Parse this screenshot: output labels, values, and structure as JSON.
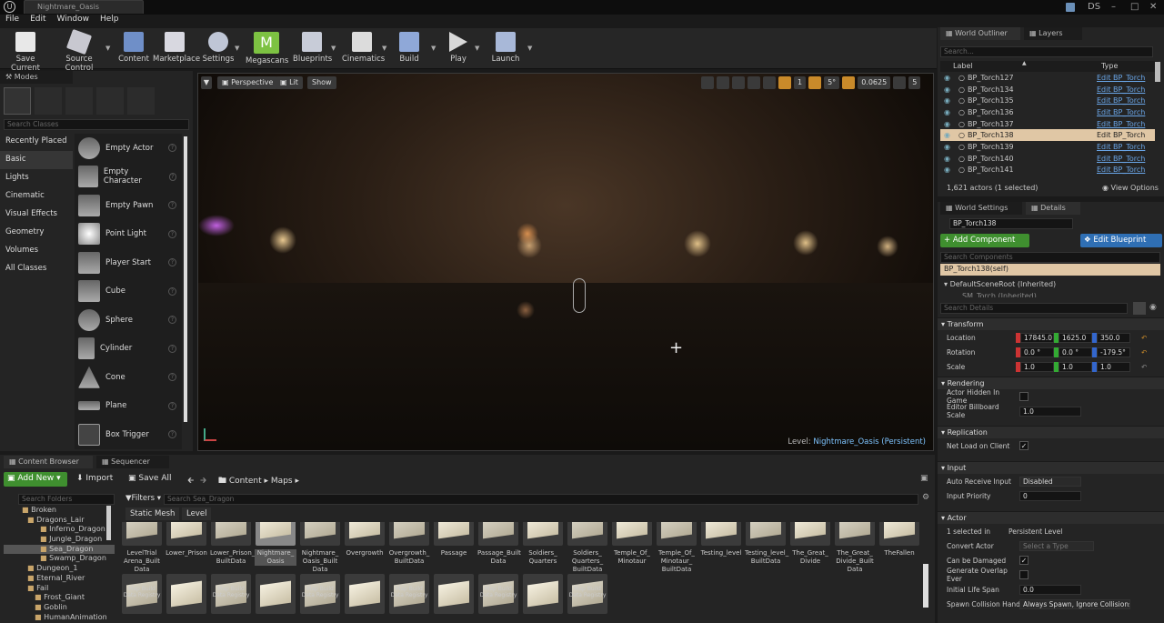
{
  "window": {
    "tab": "Nightmare_Oasis",
    "user": "DS"
  },
  "menu": [
    "File",
    "Edit",
    "Window",
    "Help"
  ],
  "toolbar": [
    "Save Current",
    "Source Control",
    "Content",
    "Marketplace",
    "Settings",
    "Megascans",
    "Blueprints",
    "Cinematics",
    "Build",
    "Play",
    "Launch"
  ],
  "modes": {
    "title": "Modes",
    "search_placeholder": "Search Classes",
    "categories": [
      "Recently Placed",
      "Basic",
      "Lights",
      "Cinematic",
      "Visual Effects",
      "Geometry",
      "Volumes",
      "All Classes"
    ],
    "items": [
      "Empty Actor",
      "Empty Character",
      "Empty Pawn",
      "Point Light",
      "Player Start",
      "Cube",
      "Sphere",
      "Cylinder",
      "Cone",
      "Plane",
      "Box Trigger"
    ]
  },
  "viewport": {
    "perspective": "Perspective",
    "lit": "Lit",
    "show": "Show",
    "grid": "1",
    "angle": "5°",
    "scale": "0.0625",
    "speed": "5",
    "level_label": "Level:",
    "level_name": "Nightmare_Oasis (Persistent)"
  },
  "outliner": {
    "tabs": [
      "World Outliner",
      "Layers"
    ],
    "search_placeholder": "Search...",
    "col_label": "Label",
    "col_type": "Type",
    "rows": [
      {
        "name": "BP_Torch127",
        "type": "Edit BP_Torch"
      },
      {
        "name": "BP_Torch134",
        "type": "Edit BP_Torch"
      },
      {
        "name": "BP_Torch135",
        "type": "Edit BP_Torch"
      },
      {
        "name": "BP_Torch136",
        "type": "Edit BP_Torch"
      },
      {
        "name": "BP_Torch137",
        "type": "Edit BP_Torch"
      },
      {
        "name": "BP_Torch138",
        "type": "Edit BP_Torch"
      },
      {
        "name": "BP_Torch139",
        "type": "Edit BP_Torch"
      },
      {
        "name": "BP_Torch140",
        "type": "Edit BP_Torch"
      },
      {
        "name": "BP_Torch141",
        "type": "Edit BP_Torch"
      }
    ],
    "selected_index": 5,
    "status": "1,621 actors (1 selected)",
    "view_options": "View Options"
  },
  "details": {
    "tabs": [
      "World Settings",
      "Details"
    ],
    "actor_name": "BP_Torch138",
    "add_component": "+ Add Component",
    "edit_blueprint": "Edit Blueprint",
    "search_components": "Search Components",
    "comp_self": "BP_Torch138(self)",
    "comp_root": "DefaultSceneRoot (Inherited)",
    "comp_child": "SM_Torch (Inherited)",
    "search_details": "Search Details",
    "transform": {
      "title": "Transform",
      "location_label": "Location",
      "rotation_label": "Rotation",
      "scale_label": "Scale",
      "location": [
        "17845.0",
        "1625.0",
        "350.0"
      ],
      "rotation": [
        "0.0 °",
        "0.0 °",
        "-179.5°"
      ],
      "scale": [
        "1.0",
        "1.0",
        "1.0"
      ]
    },
    "rendering": {
      "title": "Rendering",
      "hidden_label": "Actor Hidden In Game",
      "billboard_label": "Editor Billboard Scale",
      "billboard": "1.0"
    },
    "replication": {
      "title": "Replication",
      "net_label": "Net Load on Client"
    },
    "input": {
      "title": "Input",
      "auto_label": "Auto Receive Input",
      "auto": "Disabled",
      "priority_label": "Input Priority",
      "priority": "0"
    },
    "actor": {
      "title": "Actor",
      "selected": "1 selected in",
      "persistent": "Persistent Level",
      "convert_label": "Convert Actor",
      "convert": "Select a Type",
      "damaged_label": "Can be Damaged",
      "overlap_label": "Generate Overlap Ever",
      "lifespan_label": "Initial Life Span",
      "lifespan": "0.0",
      "spawn_label": "Spawn Collision Handl",
      "spawn": "Always Spawn, Ignore Collisions"
    }
  },
  "content": {
    "tabs": [
      "Content Browser",
      "Sequencer"
    ],
    "add_new": "Add New",
    "import": "Import",
    "save_all": "Save All",
    "path": [
      "Content",
      "Maps"
    ],
    "search_folders": "Search Folders",
    "filters": "Filters",
    "search_placeholder": "Search Sea_Dragon",
    "filter_chips": [
      "Static Mesh",
      "Level"
    ],
    "folders": [
      "Broken",
      "Dragons_Lair",
      "Inferno_Dragon",
      "Jungle_Dragon",
      "Sea_Dragon",
      "Swamp_Dragon",
      "Dungeon_1",
      "Eternal_River",
      "Fail",
      "Frost_Giant",
      "Goblin",
      "HumanAnimation"
    ],
    "row1": [
      {
        "tag": "Data Registry",
        "name": "LevelTrial Arena_Built Data"
      },
      {
        "tag": "",
        "name": "Lower_Prison"
      },
      {
        "tag": "Data Registry",
        "name": "Lower_Prison_ BuiltData"
      },
      {
        "tag": "",
        "name": "Nightmare_ Oasis"
      },
      {
        "tag": "Data Registry",
        "name": "Nightmare_ Oasis_Built Data"
      },
      {
        "tag": "",
        "name": "Overgrowth"
      },
      {
        "tag": "Data Registry",
        "name": "Overgrowth_ BuiltData"
      },
      {
        "tag": "",
        "name": "Passage"
      },
      {
        "tag": "Data Registry",
        "name": "Passage_Built Data"
      },
      {
        "tag": "",
        "name": "Soldiers_ Quarters"
      },
      {
        "tag": "Data Registry",
        "name": "Soldiers_ Quarters_ BuiltData"
      },
      {
        "tag": "",
        "name": "Temple_Of_ Minotaur"
      },
      {
        "tag": "Data Registry",
        "name": "Temple_Of_ Minotaur_ BuiltData"
      },
      {
        "tag": "",
        "name": "Testing_level"
      },
      {
        "tag": "Data Registry",
        "name": "Testing_level_ BuiltData"
      },
      {
        "tag": "",
        "name": "The_Great_ Divide"
      },
      {
        "tag": "Data Registry",
        "name": "The_Great_ Divide_Built Data"
      },
      {
        "tag": "",
        "name": "TheFallen"
      }
    ],
    "row2_tags": [
      "Map Build Data Registry",
      "",
      "Map Build Data Registry",
      "",
      "Map Build Data Registry",
      "",
      "Map Build Data Registry",
      "",
      "Map Build Data Registry",
      "",
      "Map Build Data Registry"
    ]
  }
}
